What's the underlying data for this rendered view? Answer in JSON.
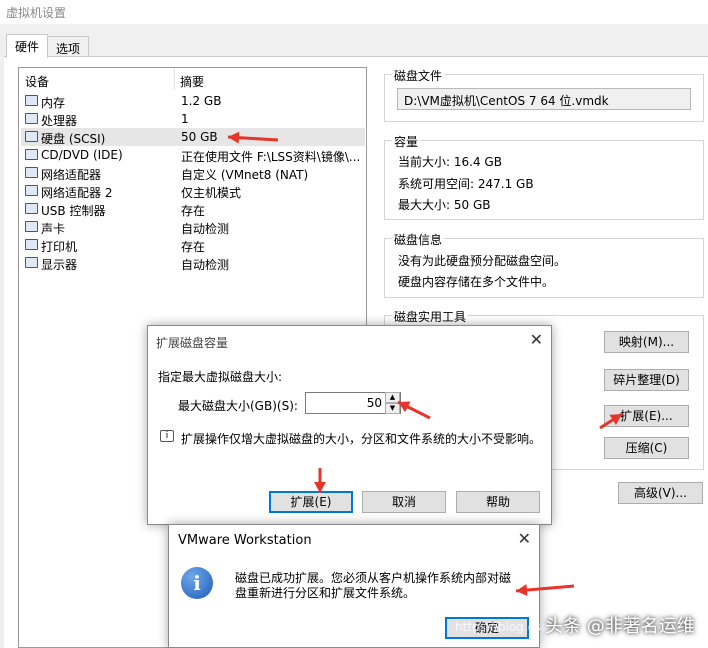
{
  "window": {
    "title": "虚拟机设置"
  },
  "tabs": [
    {
      "label": "硬件"
    },
    {
      "label": "选项"
    }
  ],
  "device_list": {
    "headers": {
      "device": "设备",
      "summary": "摘要"
    },
    "rows": [
      {
        "name": "内存",
        "summary": "1.2 GB",
        "icon": "memory-icon"
      },
      {
        "name": "处理器",
        "summary": "1",
        "icon": "processor-icon"
      },
      {
        "name": "硬盘 (SCSI)",
        "summary": "50 GB",
        "icon": "harddisk-icon",
        "selected": true
      },
      {
        "name": "CD/DVD (IDE)",
        "summary": "正在使用文件 F:\\LSS资料\\镜像\\...",
        "icon": "cd-dvd-icon"
      },
      {
        "name": "网络适配器",
        "summary": "自定义 (VMnet8 (NAT)",
        "icon": "network-icon"
      },
      {
        "name": "网络适配器 2",
        "summary": "仅主机模式",
        "icon": "network-icon"
      },
      {
        "name": "USB 控制器",
        "summary": "存在",
        "icon": "usb-icon"
      },
      {
        "name": "声卡",
        "summary": "自动检测",
        "icon": "sound-icon"
      },
      {
        "name": "打印机",
        "summary": "存在",
        "icon": "printer-icon"
      },
      {
        "name": "显示器",
        "summary": "自动检测",
        "icon": "display-icon"
      }
    ]
  },
  "disk_file": {
    "title": "磁盘文件",
    "path": "D:\\VM虚拟机\\CentOS 7 64 位.vmdk"
  },
  "capacity": {
    "title": "容量",
    "current_size": "当前大小: 16.4 GB",
    "available_space": "系统可用空间: 247.1 GB",
    "max_size": "最大大小: 50 GB"
  },
  "disk_info": {
    "title": "磁盘信息",
    "line1": "没有为此硬盘预分配磁盘空间。",
    "line2": "硬盘内容存储在多个文件中。"
  },
  "disk_utilities": {
    "title": "磁盘实用工具",
    "map_button": "映射(M)...",
    "defrag_button": "碎片整理(D)",
    "expand_button": "扩展(E)...",
    "compact_button": "压缩(C)",
    "advanced_button": "高级(V)..."
  },
  "expand_dialog": {
    "title": "扩展磁盘容量",
    "label": "指定最大虚拟磁盘大小:",
    "field_label": "最大磁盘大小(GB)(S):",
    "field_value": "50",
    "info": "扩展操作仅增大虚拟磁盘的大小，分区和文件系统的大小不受影响。",
    "expand_button": "扩展(E)",
    "cancel_button": "取消",
    "help_button": "帮助",
    "close_glyph": "✕"
  },
  "vmware_dialog": {
    "title": "VMware Workstation",
    "line1": "磁盘已成功扩展。您必须从客户机操作系统内部对磁",
    "line2": "盘重新进行分区和扩展文件系统。",
    "ok_button": "确定",
    "close_glyph": "✕",
    "info_glyph": "i"
  },
  "watermark": {
    "text": "头条 @非著名运维",
    "url": "https://blog.csdn.net"
  },
  "colors": {
    "arrow": "#e8352c",
    "selection": "#e6e6e6",
    "accent": "#0078d7"
  }
}
